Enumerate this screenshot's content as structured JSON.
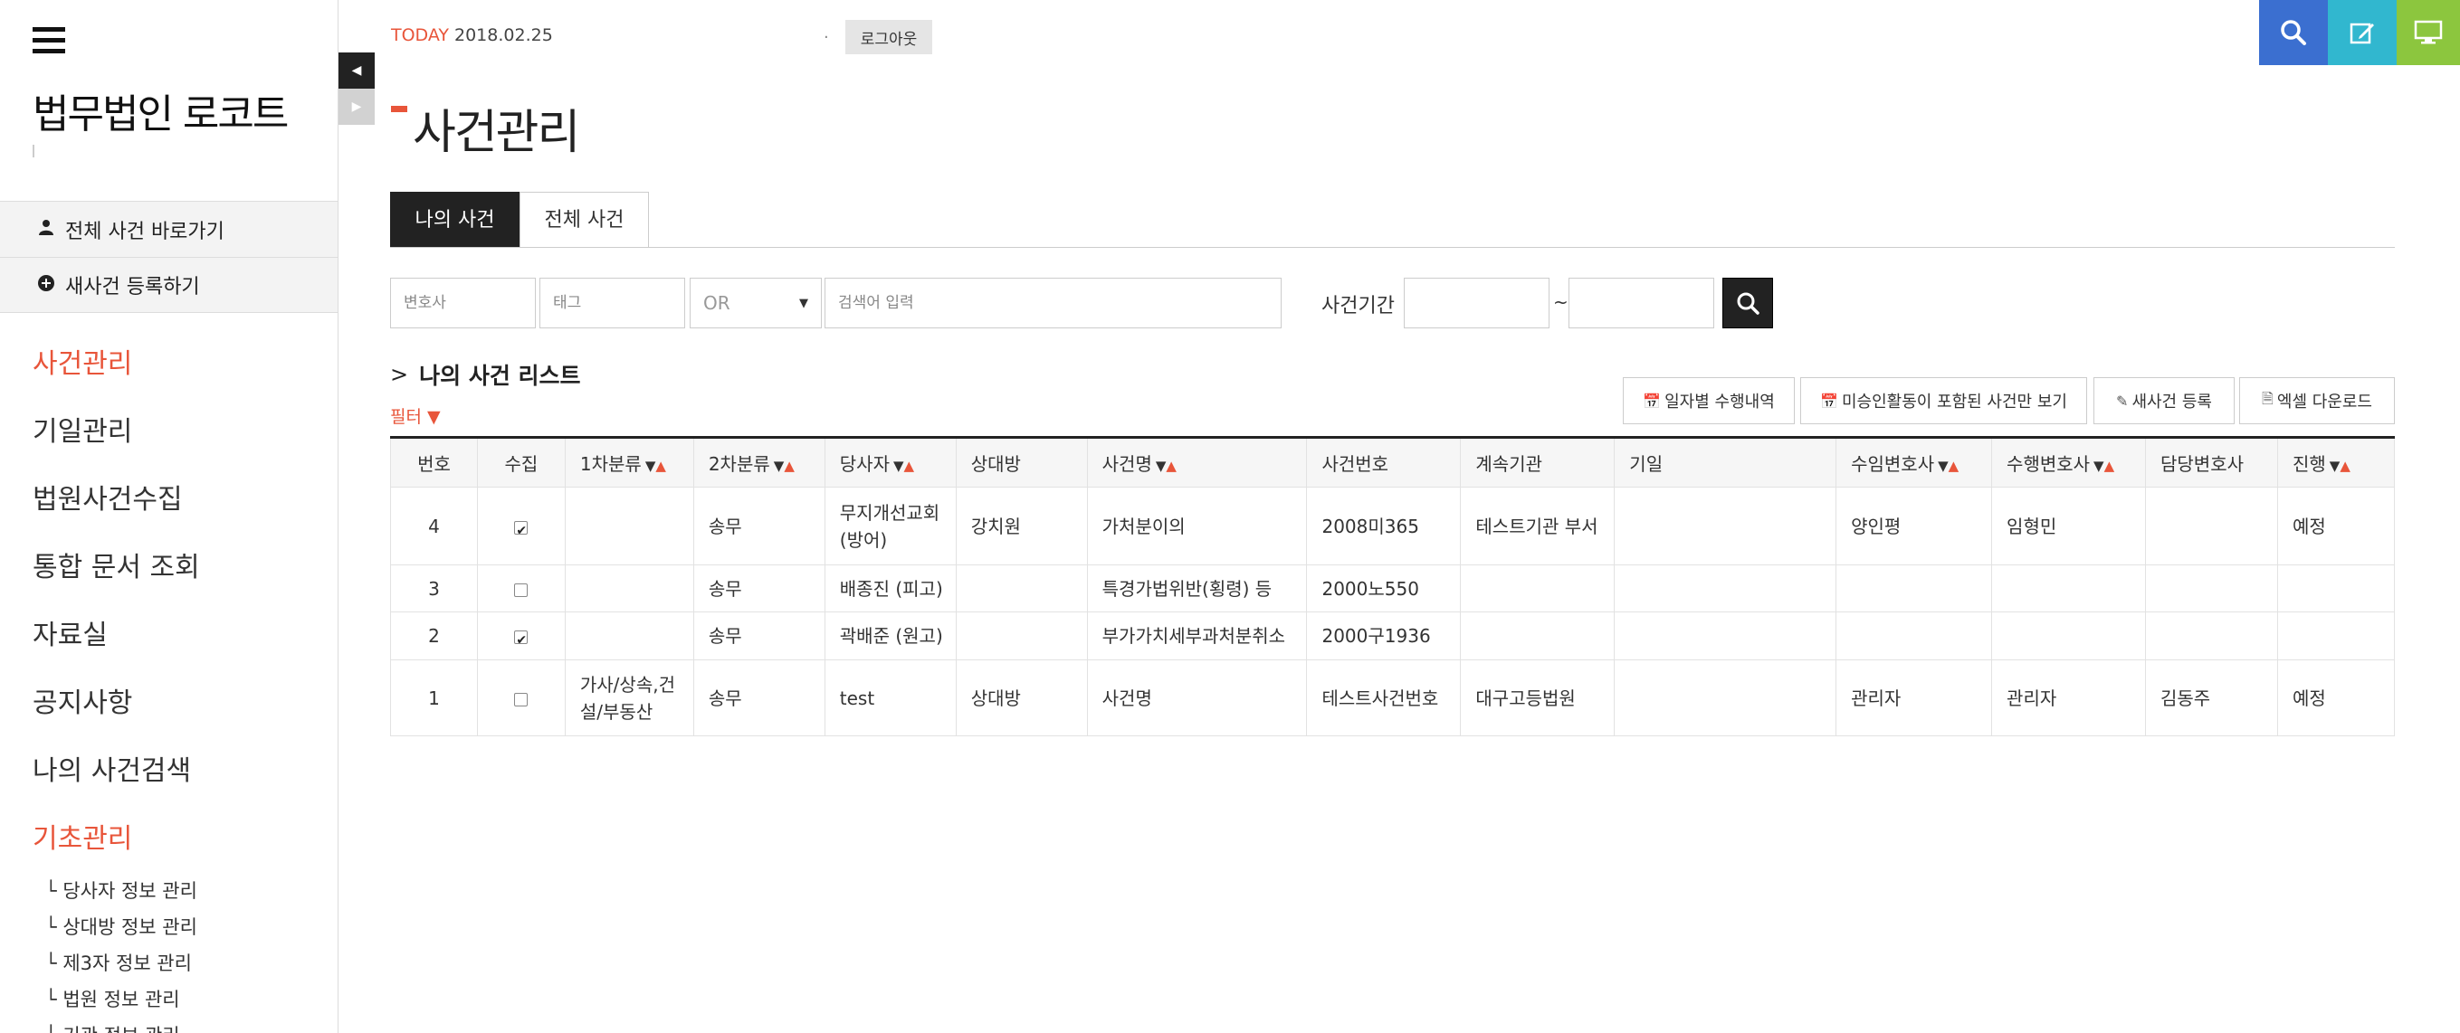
{
  "sidebar": {
    "firm_name": "법무법인 로코트",
    "quick_links": [
      {
        "label": "전체 사건 바로가기",
        "icon": "user-icon"
      },
      {
        "label": "새사건 등록하기",
        "icon": "plus-circle-icon"
      }
    ],
    "nav": [
      {
        "label": "사건관리",
        "active": true
      },
      {
        "label": "기일관리",
        "active": false
      },
      {
        "label": "법원사건수집",
        "active": false
      },
      {
        "label": "통합 문서 조회",
        "active": false
      },
      {
        "label": "자료실",
        "active": false
      },
      {
        "label": "공지사항",
        "active": false
      },
      {
        "label": "나의 사건검색",
        "active": false
      },
      {
        "label": "기초관리",
        "active": true
      }
    ],
    "sub_nav": [
      "└ 당사자 정보 관리",
      "└ 상대방 정보 관리",
      "└ 제3자 정보 관리",
      "└ 법원 정보 관리",
      "└ 기관 정보 관리"
    ]
  },
  "topbar": {
    "today_label": "TODAY",
    "today_date": "2018.02.25",
    "separator": ".",
    "logout_label": "로그아웃",
    "icons": [
      "search-icon",
      "edit-icon",
      "monitor-icon"
    ],
    "colors": {
      "search": "#3b6fd0",
      "edit": "#31b7cf",
      "monitor": "#8cc63e"
    }
  },
  "page": {
    "title": "사건관리",
    "accent": "#e8553a"
  },
  "tabs": [
    {
      "label": "나의 사건",
      "active": true
    },
    {
      "label": "전체 사건",
      "active": false
    }
  ],
  "search": {
    "lawyer_placeholder": "변호사",
    "tag_placeholder": "태그",
    "operator_value": "OR",
    "keyword_placeholder": "검색어 입력",
    "period_label": "사건기간",
    "period_separator": "~"
  },
  "list": {
    "title": "나의 사건 리스트",
    "filter_label": "필터 ▼",
    "actions": [
      {
        "label": "일자별 수행내역",
        "icon": "calendar-icon"
      },
      {
        "label": "미승인활동이 포함된 사건만 보기",
        "icon": "calendar-icon"
      },
      {
        "label": "새사건 등록",
        "icon": "edit-icon"
      },
      {
        "label": "엑셀 다운로드",
        "icon": "excel-file-icon"
      }
    ]
  },
  "table": {
    "columns": [
      {
        "label": "번호",
        "sortable": false
      },
      {
        "label": "수집",
        "sortable": false
      },
      {
        "label": "1차분류",
        "sortable": true
      },
      {
        "label": "2차분류",
        "sortable": true
      },
      {
        "label": "당사자",
        "sortable": true
      },
      {
        "label": "상대방",
        "sortable": false
      },
      {
        "label": "사건명",
        "sortable": true
      },
      {
        "label": "사건번호",
        "sortable": false
      },
      {
        "label": "계속기관",
        "sortable": false
      },
      {
        "label": "기일",
        "sortable": false
      },
      {
        "label": "수임변호사",
        "sortable": true
      },
      {
        "label": "수행변호사",
        "sortable": true
      },
      {
        "label": "담당변호사",
        "sortable": false
      },
      {
        "label": "진행",
        "sortable": true
      }
    ],
    "rows": [
      {
        "no": "4",
        "collected": true,
        "cat1": "",
        "cat2": "송무",
        "party": "무지개선교회 (방어)",
        "opponent": "강치원",
        "case_name": "가처분이의",
        "case_no": "2008미365",
        "agency": "테스트기관 부서",
        "date": "",
        "retain": "양인평",
        "perform": "임형민",
        "charge": "",
        "status": "예정"
      },
      {
        "no": "3",
        "collected": false,
        "cat1": "",
        "cat2": "송무",
        "party": "배종진 (피고)",
        "opponent": "",
        "case_name": "특경가법위반(횡령) 등",
        "case_no": "2000노550",
        "agency": "",
        "date": "",
        "retain": "",
        "perform": "",
        "charge": "",
        "status": ""
      },
      {
        "no": "2",
        "collected": true,
        "cat1": "",
        "cat2": "송무",
        "party": "곽배준 (원고)",
        "opponent": "",
        "case_name": "부가가치세부과처분취소",
        "case_no": "2000구1936",
        "agency": "",
        "date": "",
        "retain": "",
        "perform": "",
        "charge": "",
        "status": ""
      },
      {
        "no": "1",
        "collected": false,
        "cat1": "가사/상속,건설/부동산",
        "cat2": "송무",
        "party": "test",
        "opponent": "상대방",
        "case_name": "사건명",
        "case_no": "테스트사건번호",
        "agency": "대구고등법원",
        "date": "",
        "retain": "관리자",
        "perform": "관리자",
        "charge": "김동주",
        "status": "예정"
      }
    ]
  }
}
